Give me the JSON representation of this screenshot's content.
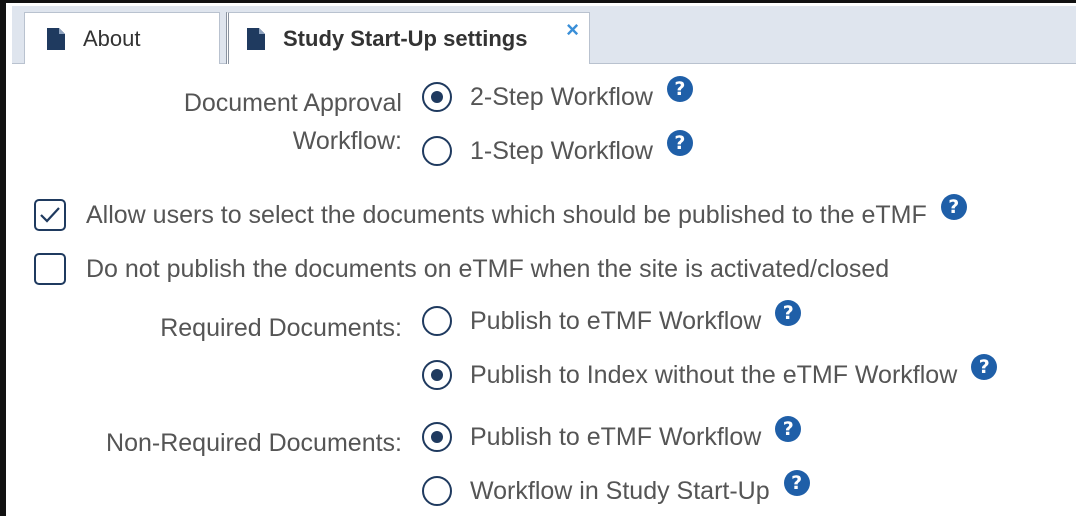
{
  "tabs": [
    {
      "label": "About",
      "icon": "document-icon",
      "active": false
    },
    {
      "label": "Study Start-Up settings",
      "icon": "document-icon",
      "active": true,
      "close": "×"
    }
  ],
  "approval": {
    "label_line1": "Document Approval",
    "label_line2": "Workflow:",
    "options": [
      {
        "label": "2-Step Workflow",
        "selected": true
      },
      {
        "label": "1-Step Workflow",
        "selected": false
      }
    ]
  },
  "checkboxes": [
    {
      "label": "Allow users to select the documents which should be published to the eTMF",
      "checked": true,
      "help": true
    },
    {
      "label": "Do not publish the documents on eTMF when the site is activated/closed",
      "checked": false,
      "help": false
    }
  ],
  "required": {
    "label": "Required Documents:",
    "options": [
      {
        "label": "Publish to eTMF Workflow",
        "selected": false
      },
      {
        "label": "Publish to Index without the eTMF Workflow",
        "selected": true
      }
    ]
  },
  "non_required": {
    "label": "Non-Required Documents:",
    "options": [
      {
        "label": "Publish to eTMF Workflow",
        "selected": true
      },
      {
        "label": "Workflow in Study Start-Up",
        "selected": false
      }
    ]
  },
  "help_glyph": "?",
  "colors": {
    "accent": "#1f3a5f",
    "help": "#1f5fa8",
    "close": "#3a8fd8",
    "tabstrip": "#dfe5ee"
  }
}
